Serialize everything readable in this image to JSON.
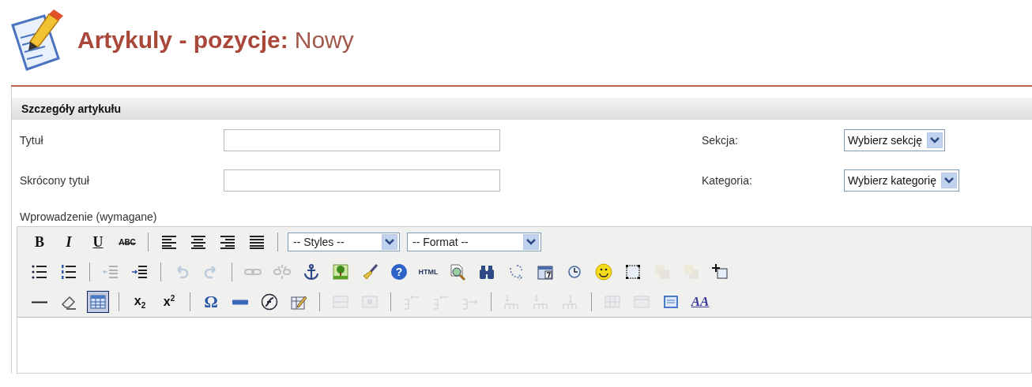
{
  "header": {
    "title": "Artykuly - pozycje:",
    "subtitle": "Nowy"
  },
  "panel": {
    "title": "Szczegóły artykułu",
    "rows": [
      {
        "label": "Tytuł",
        "side_label": "Sekcja:",
        "side_select": "Wybierz sekcję"
      },
      {
        "label": "Skrócony tytuł",
        "side_label": "Kategoria:",
        "side_select": "Wybierz kategorię"
      }
    ]
  },
  "editor": {
    "label": "Wprowadzenie (wymagane)",
    "toolbar_rows": [
      [
        {
          "kind": "button",
          "label": "B",
          "disabled": false,
          "selected": false
        },
        {
          "kind": "button",
          "label": "I",
          "disabled": false,
          "selected": false
        },
        {
          "kind": "button",
          "label": "U",
          "disabled": false,
          "selected": false
        },
        {
          "kind": "button",
          "label": "ABC",
          "disabled": false,
          "selected": false
        },
        {
          "kind": "separator"
        },
        {
          "kind": "button",
          "disabled": false,
          "selected": false
        },
        {
          "kind": "button",
          "disabled": false,
          "selected": false
        },
        {
          "kind": "button",
          "disabled": false,
          "selected": false
        },
        {
          "kind": "button",
          "disabled": false,
          "selected": false
        },
        {
          "kind": "separator"
        },
        {
          "kind": "select",
          "value": "-- Styles --"
        },
        {
          "kind": "select",
          "value": "-- Format --"
        }
      ],
      [
        {
          "kind": "button",
          "disabled": false,
          "selected": false
        },
        {
          "kind": "button",
          "disabled": false,
          "selected": false
        },
        {
          "kind": "separator"
        },
        {
          "kind": "button",
          "disabled": true,
          "selected": false
        },
        {
          "kind": "button",
          "disabled": false,
          "selected": false
        },
        {
          "kind": "separator"
        },
        {
          "kind": "button",
          "disabled": true,
          "selected": false
        },
        {
          "kind": "button",
          "disabled": true,
          "selected": false
        },
        {
          "kind": "separator"
        },
        {
          "kind": "button",
          "disabled": true,
          "selected": false
        },
        {
          "kind": "button",
          "disabled": true,
          "selected": false
        },
        {
          "kind": "button",
          "disabled": false,
          "selected": false
        },
        {
          "kind": "button",
          "disabled": false,
          "selected": false
        },
        {
          "kind": "button",
          "disabled": false,
          "selected": false
        },
        {
          "kind": "button",
          "label": "?",
          "disabled": false,
          "selected": false
        },
        {
          "kind": "button",
          "label": "HTML",
          "disabled": false,
          "selected": false
        },
        {
          "kind": "button",
          "disabled": false,
          "selected": false
        },
        {
          "kind": "button",
          "disabled": false,
          "selected": false
        },
        {
          "kind": "button",
          "disabled": false,
          "selected": false
        },
        {
          "kind": "button",
          "disabled": false,
          "selected": false
        },
        {
          "kind": "button",
          "disabled": false,
          "selected": false
        },
        {
          "kind": "button",
          "disabled": false,
          "selected": false
        },
        {
          "kind": "button",
          "disabled": false,
          "selected": false
        },
        {
          "kind": "button",
          "disabled": true,
          "selected": false
        },
        {
          "kind": "button",
          "disabled": true,
          "selected": false
        },
        {
          "kind": "button",
          "disabled": false,
          "selected": false
        }
      ],
      [
        {
          "kind": "button",
          "disabled": false,
          "selected": false
        },
        {
          "kind": "button",
          "disabled": false,
          "selected": false
        },
        {
          "kind": "button",
          "disabled": false,
          "selected": true
        },
        {
          "kind": "separator"
        },
        {
          "kind": "button",
          "label": "x$_{2}$",
          "disabled": false,
          "selected": false
        },
        {
          "kind": "button",
          "label": "x$^{2}$",
          "disabled": false,
          "selected": false
        },
        {
          "kind": "separator"
        },
        {
          "kind": "button",
          "label": "Ω",
          "disabled": false,
          "selected": false
        },
        {
          "kind": "button",
          "disabled": false,
          "selected": false
        },
        {
          "kind": "button",
          "disabled": false,
          "selected": false
        },
        {
          "kind": "button",
          "disabled": false,
          "selected": false
        },
        {
          "kind": "separator"
        },
        {
          "kind": "button",
          "disabled": true,
          "selected": false
        },
        {
          "kind": "button",
          "disabled": true,
          "selected": false
        },
        {
          "kind": "separator"
        },
        {
          "kind": "button",
          "disabled": true,
          "selected": false
        },
        {
          "kind": "button",
          "disabled": true,
          "selected": false
        },
        {
          "kind": "button",
          "disabled": true,
          "selected": false
        },
        {
          "kind": "separator"
        },
        {
          "kind": "button",
          "disabled": true,
          "selected": false
        },
        {
          "kind": "button",
          "disabled": true,
          "selected": false
        },
        {
          "kind": "button",
          "disabled": true,
          "selected": false
        },
        {
          "kind": "separator"
        },
        {
          "kind": "button",
          "disabled": true,
          "selected": false
        },
        {
          "kind": "button",
          "disabled": true,
          "selected": false
        },
        {
          "kind": "button",
          "disabled": false,
          "selected": false
        },
        {
          "kind": "button",
          "label": "AA",
          "disabled": false,
          "selected": false
        }
      ]
    ]
  }
}
